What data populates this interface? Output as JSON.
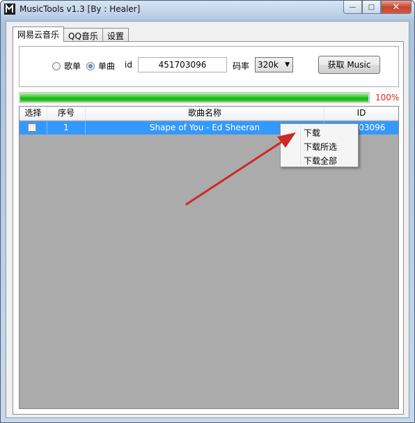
{
  "window": {
    "title": "MusicTools v1.3 [By : Healer]",
    "minimize_glyph": "—",
    "maximize_glyph": "□",
    "close_glyph": "✕"
  },
  "tabs": [
    "网易云音乐",
    "QQ音乐",
    "设置"
  ],
  "mode": {
    "option_playlist": "歌单",
    "option_single": "单曲",
    "selected": "单曲"
  },
  "id_field": {
    "label": "id",
    "value": "451703096"
  },
  "bitrate": {
    "label": "码率",
    "value": "320k"
  },
  "fetch_button": "获取 Music",
  "progress": {
    "value": 100,
    "text": "100%"
  },
  "table": {
    "headers": [
      "选择",
      "序号",
      "歌曲名称",
      "ID"
    ],
    "rows": [
      {
        "checked": false,
        "index": "1",
        "name": "Shape of You - Ed Sheeran",
        "id": "451703096"
      }
    ]
  },
  "context_menu": [
    "下载",
    "下载所选",
    "下载全部"
  ],
  "colors": {
    "selection": "#3399ff",
    "progress": "#14b011",
    "percent_text": "#d9241c",
    "annotation_arrow": "#cc2a22"
  }
}
